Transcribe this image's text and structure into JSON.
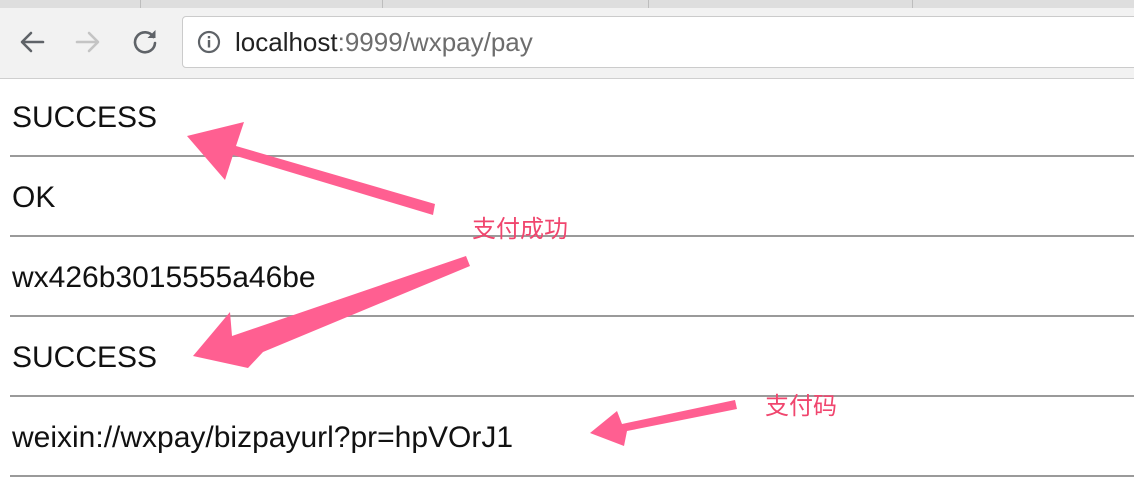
{
  "browser": {
    "url_host": "localhost",
    "url_rest": ":9999/wxpay/pay",
    "icons": {
      "back": "arrow-left-icon",
      "forward": "arrow-right-icon",
      "reload": "reload-icon",
      "site_info": "info-circle-icon"
    }
  },
  "page": {
    "rows": [
      "SUCCESS",
      "OK",
      "wx426b3015555a46be",
      "SUCCESS",
      "weixin://wxpay/bizpayurl?pr=hpVOrJ1"
    ]
  },
  "annotations": {
    "payment_success": "支付成功",
    "payment_code": "支付码",
    "color": "#ff5f91"
  }
}
